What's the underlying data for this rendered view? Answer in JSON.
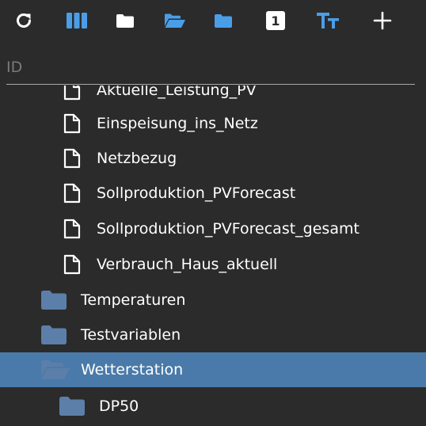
{
  "toolbar": {
    "buttons": [
      {
        "name": "refresh-icon"
      },
      {
        "name": "columns-icon"
      },
      {
        "name": "folder-icon"
      },
      {
        "name": "folder-open-icon"
      },
      {
        "name": "folder-blue-icon"
      },
      {
        "name": "number-one-badge-icon",
        "text": "1"
      },
      {
        "name": "text-size-icon"
      },
      {
        "name": "plus-icon"
      }
    ],
    "accent": "#4a9ee8"
  },
  "column_header": {
    "label": "ID"
  },
  "tree": {
    "files": [
      {
        "label": "Aktuelle_Leistung_PV"
      },
      {
        "label": "Einspeisung_ins_Netz"
      },
      {
        "label": "Netzbezug"
      },
      {
        "label": "Sollproduktion_PVForecast"
      },
      {
        "label": "Sollproduktion_PVForecast_gesamt"
      },
      {
        "label": "Verbrauch_Haus_aktuell"
      }
    ],
    "folders": [
      {
        "label": "Temperaturen"
      },
      {
        "label": "Testvariablen"
      },
      {
        "label": "Wetterstation",
        "selected": true
      },
      {
        "label": "DP50"
      }
    ],
    "selected_color": "#4a7aa9",
    "folder_color": "#5b7fa8"
  }
}
